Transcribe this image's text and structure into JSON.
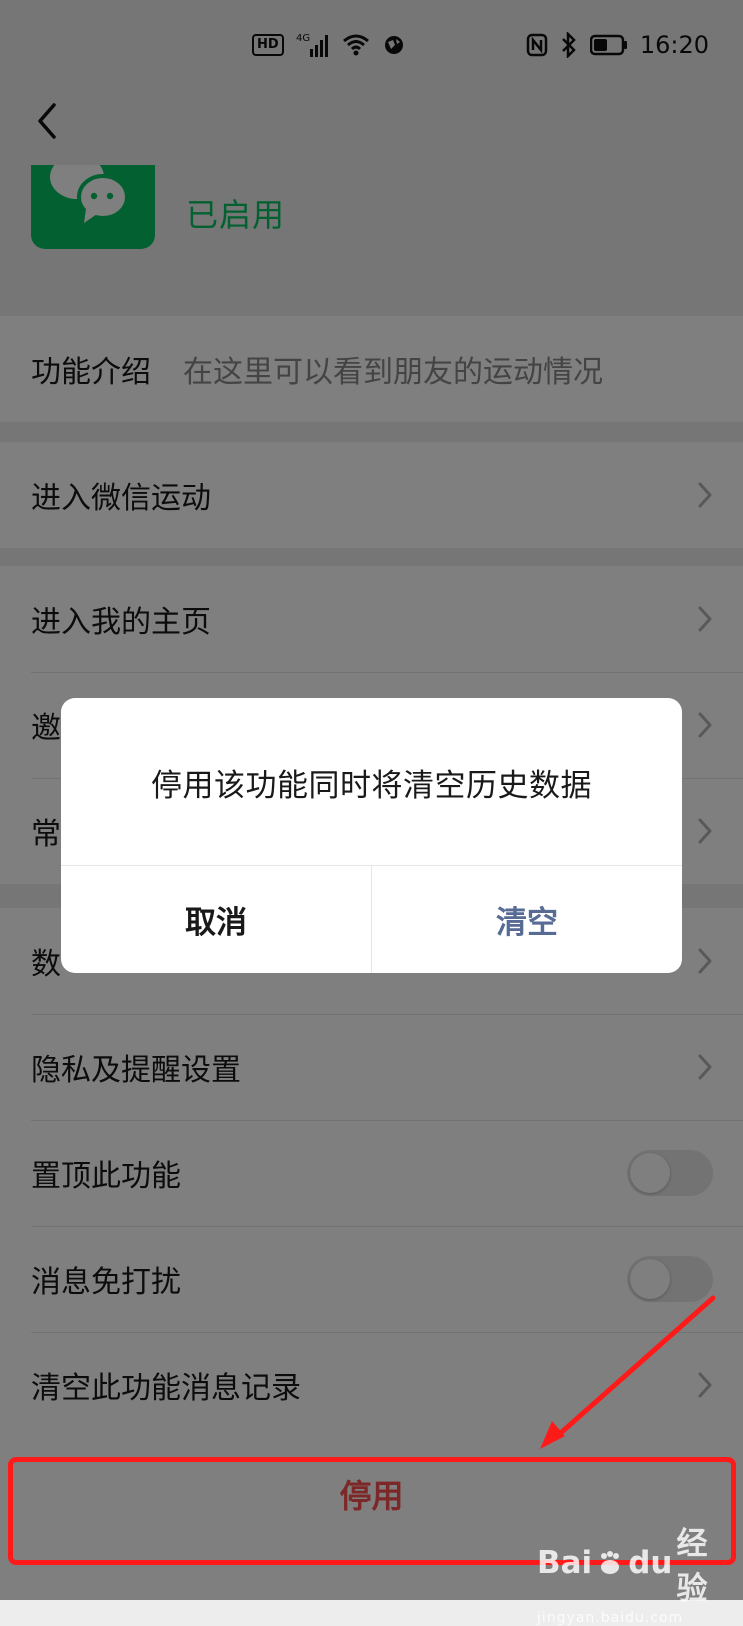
{
  "status_bar": {
    "hd_label": "HD",
    "network_label": "4G",
    "time": "16:20"
  },
  "header": {
    "enabled_status": "已启用"
  },
  "sections": {
    "feature_intro": {
      "label": "功能介绍",
      "description": "在这里可以看到朋友的运动情况"
    },
    "enter_wechat_sport": {
      "label": "进入微信运动"
    },
    "profile_group": {
      "items": [
        {
          "label": "进入我的主页"
        },
        {
          "label": "邀"
        },
        {
          "label": "常"
        }
      ]
    },
    "settings_group": {
      "items": [
        {
          "label": "数"
        },
        {
          "label": "隐私及提醒设置"
        },
        {
          "label": "置顶此功能"
        },
        {
          "label": "消息免打扰"
        },
        {
          "label": "清空此功能消息记录"
        }
      ]
    }
  },
  "footer": {
    "disable_label": "停用"
  },
  "dialog": {
    "message": "停用该功能同时将清空历史数据",
    "cancel_label": "取消",
    "confirm_label": "清空"
  },
  "watermark": {
    "brand": "Bai",
    "brand_suffix": "du",
    "product": "经验",
    "domain": "jingyan.baidu.com"
  },
  "colors": {
    "wechat_green": "#07c160",
    "link_blue": "#576b95",
    "danger_red": "#fa5151",
    "annotation_red": "#ff1a1a"
  },
  "icons": {
    "back": "chevron-left-icon",
    "cell_arrow": "chevron-right-icon",
    "signal": "signal-icon",
    "wifi": "wifi-icon",
    "nfc": "nfc-icon",
    "bluetooth": "bluetooth-icon",
    "battery": "battery-icon",
    "logo": "wechat-logo-icon"
  }
}
